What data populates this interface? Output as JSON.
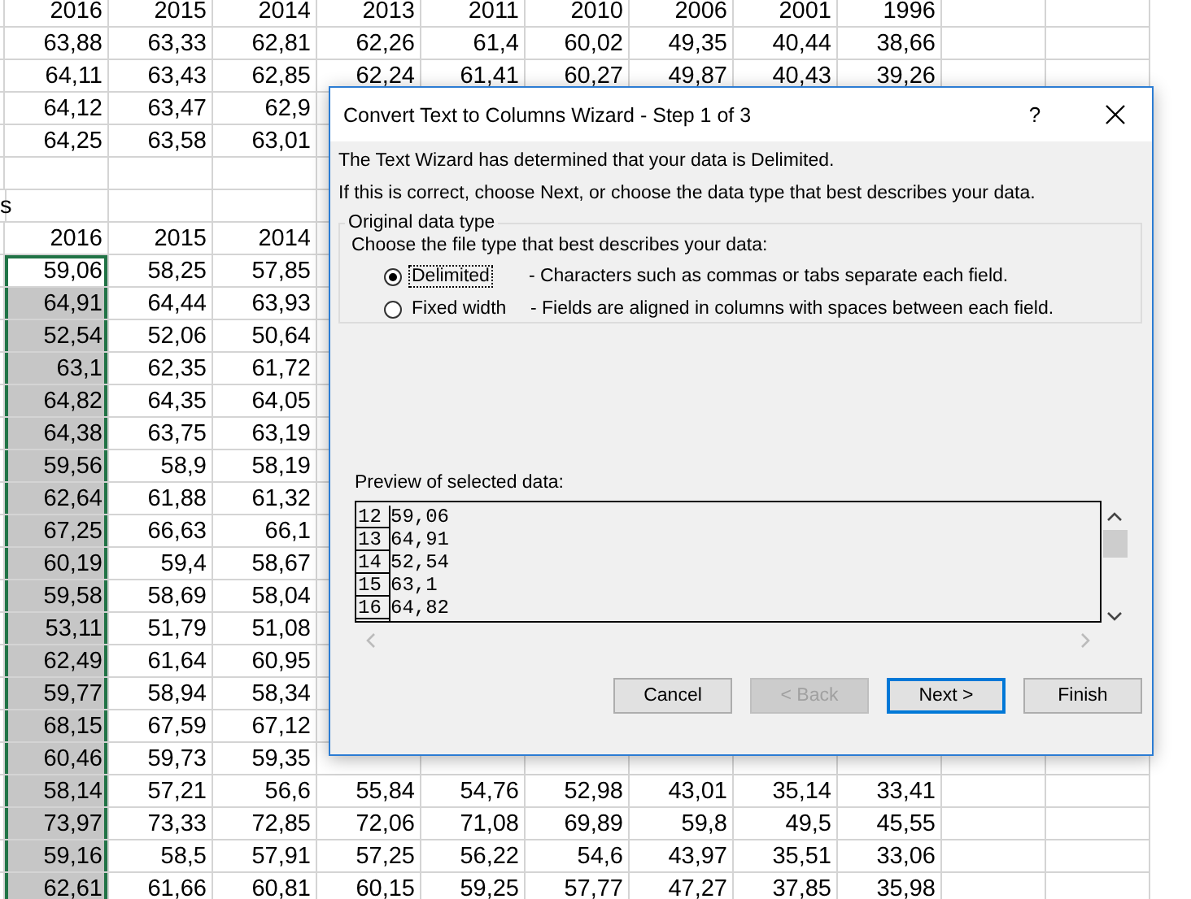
{
  "sheet": {
    "top_table": {
      "columns": [
        "2016",
        "2015",
        "2014",
        "2013",
        "2011",
        "2010",
        "2006",
        "2001",
        "1996"
      ],
      "rows": [
        [
          "63,88",
          "63,33",
          "62,81",
          "62,26",
          "61,4",
          "60,02",
          "49,35",
          "40,44",
          "38,66"
        ],
        [
          "64,11",
          "63,43",
          "62,85",
          "62,24",
          "61,41",
          "60,27",
          "49,87",
          "40,43",
          "39,26"
        ],
        [
          "64,12",
          "63,47",
          "62,9"
        ],
        [
          "64,25",
          "63,58",
          "63,01"
        ]
      ]
    },
    "lower_label": "s",
    "lower_table": {
      "columns": [
        "2016",
        "2015",
        "2014"
      ],
      "rows": [
        {
          "cells": [
            "59,06",
            "58,25",
            "57,85"
          ],
          "selected": true,
          "active": true
        },
        {
          "cells": [
            "64,91",
            "64,44",
            "63,93"
          ],
          "selected": true,
          "active": false
        },
        {
          "cells": [
            "52,54",
            "52,06",
            "50,64"
          ],
          "selected": true,
          "active": false
        },
        {
          "cells": [
            "63,1",
            "62,35",
            "61,72"
          ],
          "selected": true,
          "active": false
        },
        {
          "cells": [
            "64,82",
            "64,35",
            "64,05"
          ],
          "selected": true,
          "active": false
        },
        {
          "cells": [
            "64,38",
            "63,75",
            "63,19"
          ],
          "selected": true,
          "active": false
        },
        {
          "cells": [
            "59,56",
            "58,9",
            "58,19"
          ],
          "selected": true,
          "active": false
        },
        {
          "cells": [
            "62,64",
            "61,88",
            "61,32"
          ],
          "selected": true,
          "active": false
        },
        {
          "cells": [
            "67,25",
            "66,63",
            "66,1"
          ],
          "selected": true,
          "active": false
        },
        {
          "cells": [
            "60,19",
            "59,4",
            "58,67"
          ],
          "selected": true,
          "active": false
        },
        {
          "cells": [
            "59,58",
            "58,69",
            "58,04"
          ],
          "selected": true,
          "active": false
        },
        {
          "cells": [
            "53,11",
            "51,79",
            "51,08"
          ],
          "selected": true,
          "active": false
        },
        {
          "cells": [
            "62,49",
            "61,64",
            "60,95"
          ],
          "selected": true,
          "active": false
        },
        {
          "cells": [
            "59,77",
            "58,94",
            "58,34"
          ],
          "selected": true,
          "active": false
        },
        {
          "cells": [
            "68,15",
            "67,59",
            "67,12"
          ],
          "selected": true,
          "active": false
        },
        {
          "cells": [
            "60,46",
            "59,73",
            "59,35"
          ],
          "selected": true,
          "active": false
        },
        {
          "cells": [
            "58,14",
            "57,21",
            "56,6",
            "55,84",
            "54,76",
            "52,98",
            "43,01",
            "35,14",
            "33,41"
          ],
          "selected": true,
          "active": false
        },
        {
          "cells": [
            "73,97",
            "73,33",
            "72,85",
            "72,06",
            "71,08",
            "69,89",
            "59,8",
            "49,5",
            "45,55"
          ],
          "selected": true,
          "active": false
        },
        {
          "cells": [
            "59,16",
            "58,5",
            "57,91",
            "57,25",
            "56,22",
            "54,6",
            "43,97",
            "35,51",
            "33,06"
          ],
          "selected": true,
          "active": false
        },
        {
          "cells": [
            "62,61",
            "61,66",
            "60,81",
            "60,15",
            "59,25",
            "57,77",
            "47,27",
            "37,85",
            "35,98"
          ],
          "selected": true,
          "active": false
        }
      ]
    }
  },
  "dialog": {
    "title": "Convert Text to Columns Wizard - Step 1 of 3",
    "help": "?",
    "intro": [
      "The Text Wizard has determined that your data is Delimited.",
      "If this is correct, choose Next, or choose the data type that best describes your data."
    ],
    "group": {
      "legend": "Original data type",
      "prompt": "Choose the file type that best describes your data:",
      "options": [
        {
          "label": "Delimited",
          "description": "- Characters such as commas or tabs separate each field.",
          "selected": true,
          "focused": true
        },
        {
          "label": "Fixed width",
          "description": "- Fields are aligned in columns with spaces between each field.",
          "selected": false,
          "focused": false
        }
      ]
    },
    "preview": {
      "label": "Preview of selected data:",
      "rows": [
        {
          "line": "12",
          "text": "59,06"
        },
        {
          "line": "13",
          "text": "64,91"
        },
        {
          "line": "14",
          "text": "52,54"
        },
        {
          "line": "15",
          "text": "63,1"
        },
        {
          "line": "16",
          "text": "64,82"
        }
      ]
    },
    "buttons": [
      {
        "label": "Cancel",
        "disabled": false,
        "default": false
      },
      {
        "label": "< Back",
        "disabled": true,
        "default": false
      },
      {
        "label": "Next >",
        "disabled": false,
        "default": true
      },
      {
        "label": "Finish",
        "disabled": false,
        "default": false
      }
    ]
  }
}
